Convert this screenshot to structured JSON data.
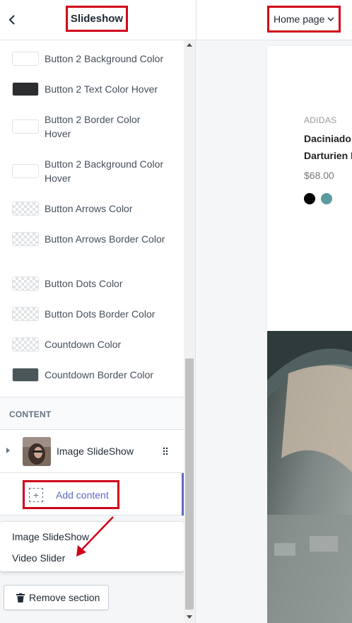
{
  "header": {
    "title": "Slideshow",
    "page_selector": "Home page"
  },
  "colors": {
    "items": [
      {
        "label": "Button 2 Background Color",
        "swatch": "#ffffff",
        "checker": false
      },
      {
        "label": "Button 2 Text Color Hover",
        "swatch": "#2b2d2f",
        "checker": false
      },
      {
        "label": "Button 2 Border Color Hover",
        "swatch": "#ffffff",
        "checker": false
      },
      {
        "label": "Button 2 Background Color Hover",
        "swatch": "#ffffff",
        "checker": false
      },
      {
        "label": "Button Arrows Color",
        "swatch": "transparent",
        "checker": true
      },
      {
        "label": "Button Arrows Border Color",
        "swatch": "transparent",
        "checker": true
      },
      {
        "label": "Button Dots Color",
        "swatch": "transparent",
        "checker": true
      },
      {
        "label": "Button Dots Border Color",
        "swatch": "transparent",
        "checker": true
      },
      {
        "label": "Countdown Color",
        "swatch": "transparent",
        "checker": true
      },
      {
        "label": "Countdown Border Color",
        "swatch": "#4b5658",
        "checker": false
      }
    ]
  },
  "content": {
    "heading": "CONTENT",
    "block_label": "Image SlideShow",
    "add_label": "Add content",
    "options": [
      "Image SlideShow",
      "Video Slider"
    ]
  },
  "footer": {
    "remove_label": "Remove section"
  },
  "preview": {
    "brand": "ADIDAS",
    "name_line1": "Daciniado l",
    "name_line2": "Darturien D",
    "price": "$68.00",
    "swatches": [
      "#000000",
      "#5b9aa0"
    ]
  },
  "accent": {
    "highlight": "#d0021b",
    "link": "#5c6ac4"
  }
}
